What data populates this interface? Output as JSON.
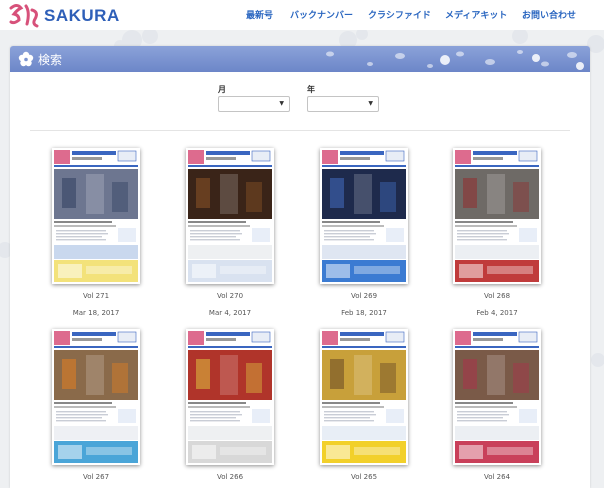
{
  "brand": {
    "name": "SAKURA",
    "colors": {
      "primary": "#2e5fb8",
      "nav": "#2a66c0",
      "logo_pink": "#d7517a"
    }
  },
  "nav": [
    {
      "label": "最新号"
    },
    {
      "label": "バックナンバー"
    },
    {
      "label": "クラシファイド"
    },
    {
      "label": "メディアキット"
    },
    {
      "label": "お問い合わせ"
    }
  ],
  "search": {
    "title": "検索",
    "month_label": "月",
    "year_label": "年",
    "month_value": "",
    "year_value": ""
  },
  "issues": [
    {
      "vol": "Vol 271",
      "date": "Mar 18, 2017",
      "headline": "熱狂",
      "sub": "朗報です!",
      "theme": "crowd"
    },
    {
      "vol": "Vol 270",
      "date": "Mar 4, 2017",
      "headline": "繰り返す月の余韻",
      "sub": "",
      "theme": "stage"
    },
    {
      "vol": "Vol 269",
      "date": "Feb 18, 2017",
      "headline": "",
      "sub": "",
      "theme": "politics"
    },
    {
      "vol": "Vol 268",
      "date": "Feb 4, 2017",
      "headline": "ここは移民の国",
      "sub": "",
      "theme": "protest"
    },
    {
      "vol": "Vol 267",
      "date": "",
      "headline": "熱戦",
      "sub": "",
      "theme": "sports"
    },
    {
      "vol": "Vol 266",
      "date": "",
      "headline": "謹賀新年",
      "sub": "",
      "theme": "newyear"
    },
    {
      "vol": "Vol 265",
      "date": "",
      "headline": "年の瀬に落語",
      "sub": "新年キャンペーン",
      "theme": "rakugo"
    },
    {
      "vol": "Vol 264",
      "date": "",
      "headline": "",
      "sub": "",
      "theme": "party"
    }
  ]
}
